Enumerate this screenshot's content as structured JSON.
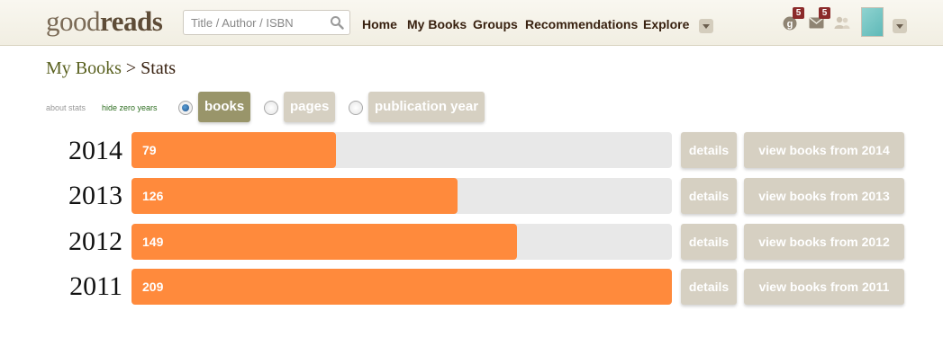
{
  "header": {
    "logo_light": "good",
    "logo_bold": "reads",
    "search_placeholder": "Title / Author / ISBN",
    "nav": [
      "Home",
      "My Books",
      "Groups",
      "Recommendations",
      "Explore"
    ],
    "notifications_count": "5",
    "messages_count": "5"
  },
  "breadcrumb": {
    "link": "My Books",
    "rest": " > Stats"
  },
  "controls": {
    "about_stats": "about stats",
    "hide_zero_years": "hide zero years",
    "options": [
      {
        "label": "books",
        "selected": true
      },
      {
        "label": "pages",
        "selected": false
      },
      {
        "label": "publication year",
        "selected": false
      }
    ]
  },
  "colors": {
    "bar": "#ff8a3c",
    "track": "#e8e8e8",
    "button": "#d6d0c2",
    "active_pill": "#99956a",
    "link": "#5a6120"
  },
  "icons": [
    "search-icon",
    "notifications-icon",
    "mail-icon",
    "friends-icon",
    "chevron-down-icon"
  ],
  "chart_data": {
    "type": "bar",
    "orientation": "horizontal",
    "categories": [
      "2014",
      "2013",
      "2012",
      "2011"
    ],
    "values": [
      79,
      126,
      149,
      209
    ],
    "xlim": [
      0,
      209
    ]
  },
  "rows": [
    {
      "year": "2014",
      "count": "79",
      "details": "details",
      "view": "view books from 2014"
    },
    {
      "year": "2013",
      "count": "126",
      "details": "details",
      "view": "view books from 2013"
    },
    {
      "year": "2012",
      "count": "149",
      "details": "details",
      "view": "view books from 2012"
    },
    {
      "year": "2011",
      "count": "209",
      "details": "details",
      "view": "view books from 2011"
    }
  ]
}
